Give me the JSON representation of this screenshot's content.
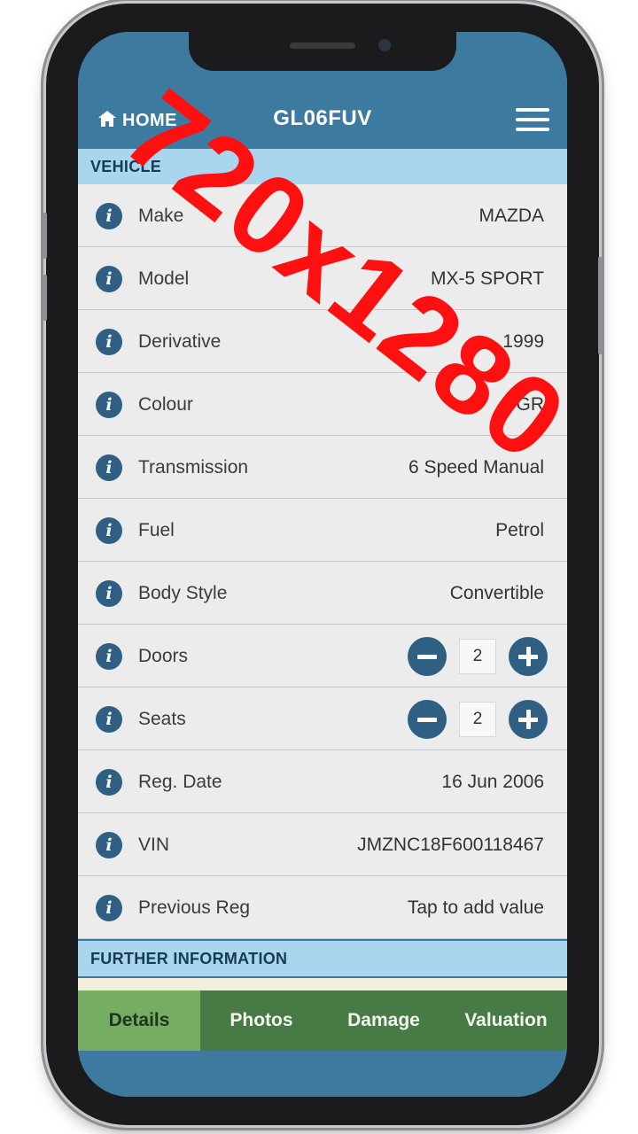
{
  "header": {
    "home_label": "HOME",
    "title": "GL06FUV",
    "menu_icon": "hamburger-menu-icon",
    "home_icon": "home-icon",
    "background_color": "#3d7aa0"
  },
  "vehicle_section": {
    "title": "VEHICLE",
    "rows": [
      {
        "label": "Make",
        "value": "MAZDA"
      },
      {
        "label": "Model",
        "value": "MX-5 SPORT"
      },
      {
        "label": "Derivative",
        "value": "1999"
      },
      {
        "label": "Colour",
        "value": "GR"
      },
      {
        "label": "Transmission",
        "value": "6 Speed Manual"
      },
      {
        "label": "Fuel",
        "value": "Petrol"
      },
      {
        "label": "Body Style",
        "value": "Convertible"
      },
      {
        "label": "Doors",
        "value": "2"
      },
      {
        "label": "Seats",
        "value": "2"
      },
      {
        "label": "Reg. Date",
        "value": "16 Jun 2006"
      },
      {
        "label": "VIN",
        "value": "JMZNC18F600118467"
      },
      {
        "label": "Previous Reg",
        "value": "Tap to add value"
      }
    ]
  },
  "further_section": {
    "title": "FURTHER INFORMATION"
  },
  "tabs": [
    {
      "label": "Details",
      "active": true
    },
    {
      "label": "Photos",
      "active": false
    },
    {
      "label": "Damage",
      "active": false
    },
    {
      "label": "Valuation",
      "active": false
    }
  ],
  "watermark": "720x1280",
  "colors": {
    "accent_blue": "#2f5f82",
    "section_header": "#a9d6ee",
    "tab_bar": "#477a45",
    "tab_active": "#75ad63"
  }
}
